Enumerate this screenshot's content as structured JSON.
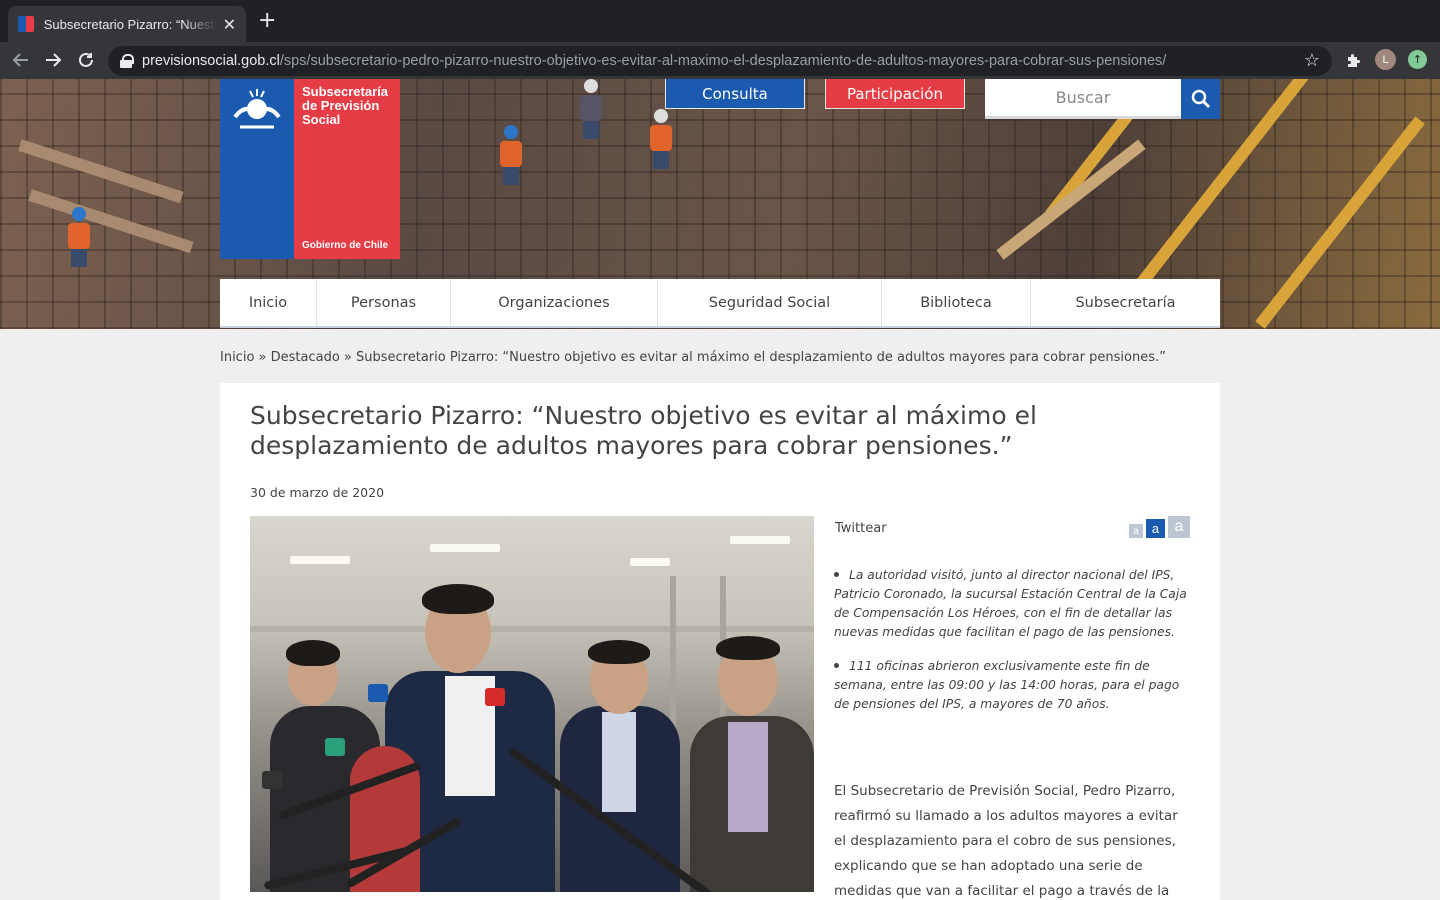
{
  "browser": {
    "tab_title": "Subsecretario Pizarro: “Nuestro objetivo es evitar al máximo el desplazamiento",
    "url_host": "previsionsocial.gob.cl",
    "url_path": "/sps/subsecretario-pedro-pizarro-nuestro-objetivo-es-evitar-al-maximo-el-desplazamiento-de-adultos-mayores-para-cobrar-sus-pensiones/",
    "avatar_letter": "L"
  },
  "logo": {
    "title_line1": "Subsecretaría",
    "title_line2": "de Previsión",
    "title_line3": "Social",
    "footer": "Gobierno de Chile"
  },
  "header": {
    "consulta_label": "Consulta",
    "participacion_label": "Participación",
    "search_placeholder": "Buscar"
  },
  "nav": {
    "items": [
      {
        "label": "Inicio"
      },
      {
        "label": "Personas"
      },
      {
        "label": "Organizaciones"
      },
      {
        "label": "Seguridad Social"
      },
      {
        "label": "Biblioteca"
      },
      {
        "label": "Subsecretaría"
      }
    ]
  },
  "breadcrumb": {
    "home": "Inicio",
    "sep": " » ",
    "section": "Destacado",
    "current": "Subsecretario Pizarro: “Nuestro objetivo es evitar al máximo el desplazamiento de adultos mayores para cobrar pensiones.”"
  },
  "article": {
    "title": "Subsecretario Pizarro: “Nuestro objetivo es evitar al máximo el desplazamiento de adultos mayores para cobrar pensiones.”",
    "date": "30 de marzo de 2020",
    "tweet_label": "Twittear",
    "font_small": "a",
    "font_medium": "a",
    "font_large": "a",
    "bullets": [
      "La autoridad visitó, junto al director nacional del IPS, Patricio Coronado, la sucursal Estación Central de la Caja de Compensación Los Héroes, con el fin de detallar las nuevas medidas que facilitan el pago de las pensiones.",
      "111 oficinas abrieron exclusivamente este fin de semana, entre las 09:00 y las 14:00 horas, para el pago de pensiones del IPS, a mayores de 70 años."
    ],
    "body": "El Subsecretario de Previsión Social, Pedro Pizarro, reafirmó su llamado a los adultos mayores a evitar el desplazamiento para el cobro de sus pensiones, explicando que se han adoptado una serie de medidas que van a facilitar el pago a través de la"
  },
  "colors": {
    "brand_blue": "#1a5bb0",
    "brand_red": "#e63c46"
  }
}
